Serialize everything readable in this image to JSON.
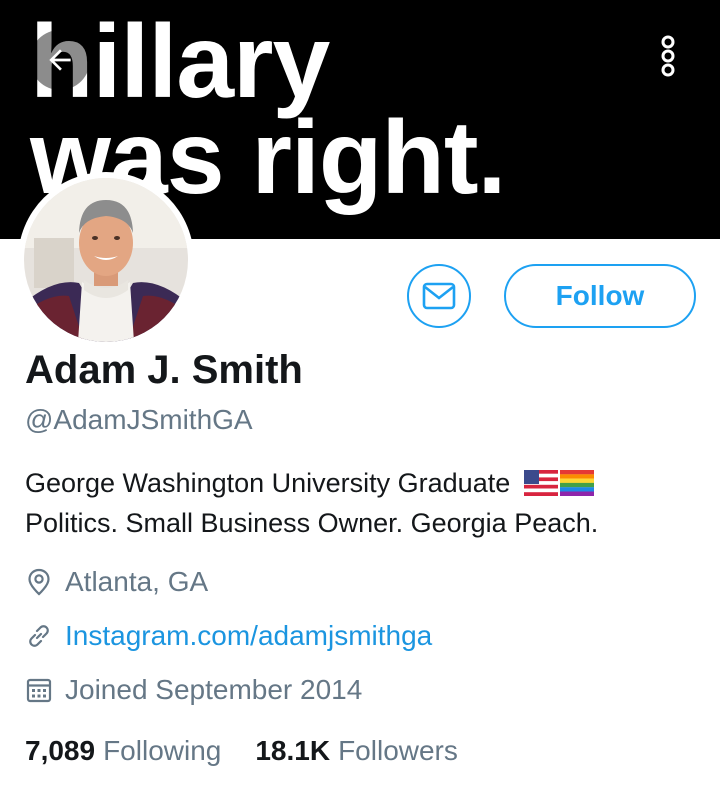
{
  "banner": {
    "line1": "hillary",
    "line2": "was right."
  },
  "header": {
    "back_icon": "arrow-left-icon",
    "menu_icon": "more-vertical-icon"
  },
  "profile": {
    "name": "Adam J. Smith",
    "handle": "@AdamJSmithGA",
    "bio_line1": "George Washington University Graduate",
    "bio_line2": "Politics. Small Business Owner. Georgia Peach.",
    "bio_emojis": [
      "us-flag-emoji",
      "rainbow-flag-emoji"
    ],
    "follow_label": "Follow",
    "location": "Atlanta, GA",
    "website": "Instagram.com/adamjsmithga",
    "joined": "Joined September 2014",
    "following_count": "7,089",
    "following_label": "Following",
    "followers_count": "18.1K",
    "followers_label": "Followers"
  },
  "colors": {
    "accent": "#1da1f2",
    "link": "#1b95e0",
    "secondary_text": "#657786",
    "primary_text": "#14171a",
    "banner_bg": "#000000"
  }
}
